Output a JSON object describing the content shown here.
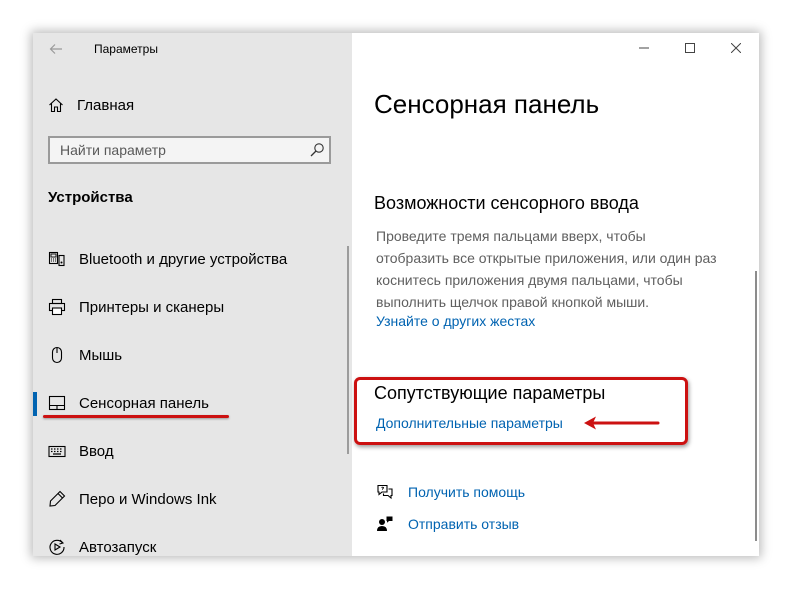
{
  "window": {
    "title": "Параметры"
  },
  "sidebar": {
    "home_label": "Главная",
    "search_placeholder": "Найти параметр",
    "section_title": "Устройства",
    "items": [
      {
        "label": "Bluetooth и другие устройства",
        "icon": "bluetooth-devices-icon"
      },
      {
        "label": "Принтеры и сканеры",
        "icon": "printer-icon"
      },
      {
        "label": "Мышь",
        "icon": "mouse-icon"
      },
      {
        "label": "Сенсорная панель",
        "icon": "touchpad-icon",
        "active": true
      },
      {
        "label": "Ввод",
        "icon": "keyboard-icon"
      },
      {
        "label": "Перо и Windows Ink",
        "icon": "pen-icon"
      },
      {
        "label": "Автозапуск",
        "icon": "autoplay-icon"
      }
    ]
  },
  "main": {
    "page_title": "Сенсорная панель",
    "gestures": {
      "heading": "Возможности сенсорного ввода",
      "description": "Проведите тремя пальцами вверх, чтобы отобразить все открытые приложения, или один раз коснитесь приложения двумя пальцами, чтобы выполнить щелчок правой кнопкой мыши.",
      "link": "Узнайте о других жестах"
    },
    "related": {
      "heading": "Сопутствующие параметры",
      "link": "Дополнительные параметры"
    },
    "help": {
      "get_help": "Получить помощь",
      "feedback": "Отправить отзыв"
    }
  },
  "colors": {
    "accent": "#0063b1",
    "annotation": "#cc1111",
    "sidebar_bg": "#e6e6e6"
  }
}
